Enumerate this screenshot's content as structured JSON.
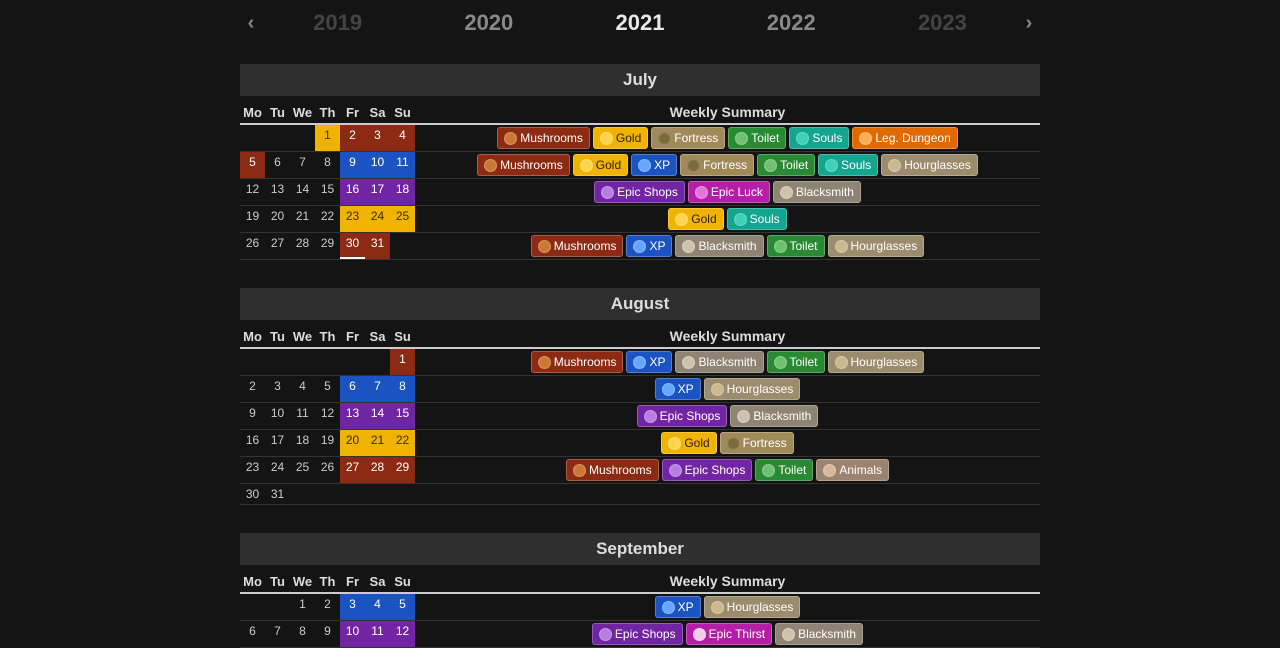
{
  "nav": {
    "prev": "‹",
    "next": "›",
    "years": [
      "2019",
      "2020",
      "2021",
      "2022",
      "2023"
    ],
    "active": "2021"
  },
  "weekdays": [
    "Mo",
    "Tu",
    "We",
    "Th",
    "Fr",
    "Sa",
    "Su"
  ],
  "summary_header": "Weekly Summary",
  "events": {
    "mushrooms": {
      "label": "Mushrooms",
      "cls": "c-mushrooms",
      "dcls": "d-mushrooms"
    },
    "gold": {
      "label": "Gold",
      "cls": "c-gold",
      "dcls": "d-gold"
    },
    "fortress": {
      "label": "Fortress",
      "cls": "c-fortress",
      "dcls": ""
    },
    "toilet": {
      "label": "Toilet",
      "cls": "c-toilet",
      "dcls": ""
    },
    "souls": {
      "label": "Souls",
      "cls": "c-souls",
      "dcls": ""
    },
    "legdungeon": {
      "label": "Leg. Dungeon",
      "cls": "c-legdungeon",
      "dcls": ""
    },
    "hourglasses": {
      "label": "Hourglasses",
      "cls": "c-hourglasses",
      "dcls": ""
    },
    "xp": {
      "label": "XP",
      "cls": "c-xp",
      "dcls": "d-xp"
    },
    "epicshops": {
      "label": "Epic Shops",
      "cls": "c-epicshops",
      "dcls": "d-epicshops"
    },
    "epicluck": {
      "label": "Epic Luck",
      "cls": "c-epicluck",
      "dcls": ""
    },
    "blacksmith": {
      "label": "Blacksmith",
      "cls": "c-blacksmith",
      "dcls": ""
    },
    "animals": {
      "label": "Animals",
      "cls": "c-animals",
      "dcls": ""
    },
    "epicthirst": {
      "label": "Epic Thirst",
      "cls": "c-epicthirst",
      "dcls": ""
    }
  },
  "months": [
    {
      "name": "July",
      "weeks": [
        {
          "days": [
            null,
            null,
            null,
            {
              "n": 1,
              "c": "gold"
            },
            {
              "n": 2,
              "c": "mushrooms"
            },
            {
              "n": 3,
              "c": "mushrooms"
            },
            {
              "n": 4,
              "c": "mushrooms"
            }
          ],
          "events": [
            "mushrooms",
            "gold",
            "fortress",
            "toilet",
            "souls",
            "legdungeon"
          ]
        },
        {
          "days": [
            {
              "n": 5,
              "c": "mushrooms"
            },
            {
              "n": 6
            },
            {
              "n": 7
            },
            {
              "n": 8
            },
            {
              "n": 9,
              "c": "xp"
            },
            {
              "n": 10,
              "c": "xp"
            },
            {
              "n": 11,
              "c": "xp"
            }
          ],
          "events": [
            "mushrooms",
            "gold",
            "xp",
            "fortress",
            "toilet",
            "souls",
            "hourglasses"
          ]
        },
        {
          "days": [
            {
              "n": 12
            },
            {
              "n": 13
            },
            {
              "n": 14
            },
            {
              "n": 15
            },
            {
              "n": 16,
              "c": "epicshops"
            },
            {
              "n": 17,
              "c": "epicshops"
            },
            {
              "n": 18,
              "c": "epicshops"
            }
          ],
          "events": [
            "epicshops",
            "epicluck",
            "blacksmith"
          ]
        },
        {
          "days": [
            {
              "n": 19
            },
            {
              "n": 20
            },
            {
              "n": 21
            },
            {
              "n": 22
            },
            {
              "n": 23,
              "c": "gold"
            },
            {
              "n": 24,
              "c": "gold"
            },
            {
              "n": 25,
              "c": "gold"
            }
          ],
          "events": [
            "gold",
            "souls"
          ]
        },
        {
          "days": [
            {
              "n": 26
            },
            {
              "n": 27
            },
            {
              "n": 28
            },
            {
              "n": 29
            },
            {
              "n": 30,
              "c": "mushrooms",
              "today": true
            },
            {
              "n": 31,
              "c": "mushrooms"
            },
            null
          ],
          "events": [
            "mushrooms",
            "xp",
            "blacksmith",
            "toilet",
            "hourglasses"
          ]
        }
      ]
    },
    {
      "name": "August",
      "weeks": [
        {
          "days": [
            null,
            null,
            null,
            null,
            null,
            null,
            {
              "n": 1,
              "c": "mushrooms"
            }
          ],
          "events": [
            "mushrooms",
            "xp",
            "blacksmith",
            "toilet",
            "hourglasses"
          ]
        },
        {
          "days": [
            {
              "n": 2
            },
            {
              "n": 3
            },
            {
              "n": 4
            },
            {
              "n": 5
            },
            {
              "n": 6,
              "c": "xp"
            },
            {
              "n": 7,
              "c": "xp"
            },
            {
              "n": 8,
              "c": "xp"
            }
          ],
          "events": [
            "xp",
            "hourglasses"
          ]
        },
        {
          "days": [
            {
              "n": 9
            },
            {
              "n": 10
            },
            {
              "n": 11
            },
            {
              "n": 12
            },
            {
              "n": 13,
              "c": "epicshops"
            },
            {
              "n": 14,
              "c": "epicshops"
            },
            {
              "n": 15,
              "c": "epicshops"
            }
          ],
          "events": [
            "epicshops",
            "blacksmith"
          ]
        },
        {
          "days": [
            {
              "n": 16
            },
            {
              "n": 17
            },
            {
              "n": 18
            },
            {
              "n": 19
            },
            {
              "n": 20,
              "c": "gold"
            },
            {
              "n": 21,
              "c": "gold"
            },
            {
              "n": 22,
              "c": "gold"
            }
          ],
          "events": [
            "gold",
            "fortress"
          ]
        },
        {
          "days": [
            {
              "n": 23
            },
            {
              "n": 24
            },
            {
              "n": 25
            },
            {
              "n": 26
            },
            {
              "n": 27,
              "c": "mushrooms"
            },
            {
              "n": 28,
              "c": "mushrooms"
            },
            {
              "n": 29,
              "c": "mushrooms"
            }
          ],
          "events": [
            "mushrooms",
            "epicshops",
            "toilet",
            "animals"
          ]
        },
        {
          "days": [
            {
              "n": 30
            },
            {
              "n": 31
            },
            null,
            null,
            null,
            null,
            null
          ],
          "events": []
        }
      ]
    },
    {
      "name": "September",
      "weeks": [
        {
          "days": [
            null,
            null,
            {
              "n": 1
            },
            {
              "n": 2
            },
            {
              "n": 3,
              "c": "xp"
            },
            {
              "n": 4,
              "c": "xp"
            },
            {
              "n": 5,
              "c": "xp"
            }
          ],
          "events": [
            "xp",
            "hourglasses"
          ]
        },
        {
          "days": [
            {
              "n": 6
            },
            {
              "n": 7
            },
            {
              "n": 8
            },
            {
              "n": 9
            },
            {
              "n": 10,
              "c": "epicshops"
            },
            {
              "n": 11,
              "c": "epicshops"
            },
            {
              "n": 12,
              "c": "epicshops"
            }
          ],
          "events": [
            "epicshops",
            "epicthirst",
            "blacksmith"
          ]
        }
      ]
    }
  ]
}
